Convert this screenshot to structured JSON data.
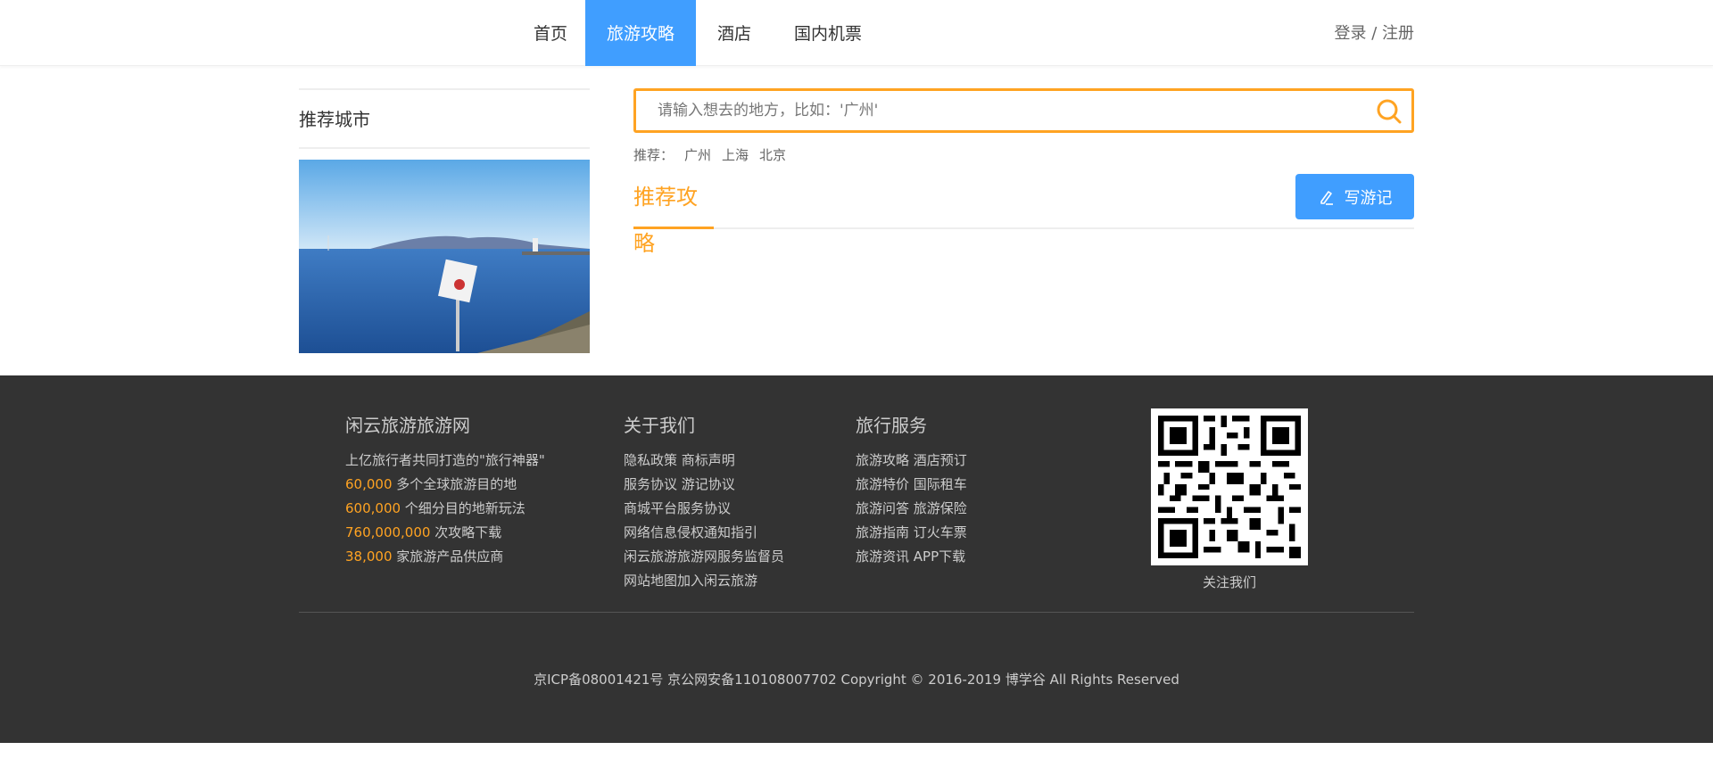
{
  "nav": {
    "items": [
      {
        "label": "首页"
      },
      {
        "label": "旅游攻略"
      },
      {
        "label": "酒店"
      },
      {
        "label": "国内机票"
      }
    ],
    "login": "登录",
    "separator": " / ",
    "register": "注册"
  },
  "aside": {
    "title": "推荐城市"
  },
  "search": {
    "placeholder": "请输入想去的地方，比如：'广州'",
    "recommend_label": "推荐：",
    "recommend_cities": [
      "广州",
      "上海",
      "北京"
    ]
  },
  "tabs": {
    "active": "推荐攻略",
    "write_button": "写游记"
  },
  "footer": {
    "col1": {
      "title": "闲云旅游旅游网",
      "lines": [
        {
          "hl": "",
          "text": "上亿旅行者共同打造的\"旅行神器\""
        },
        {
          "hl": "60,000",
          "text": " 多个全球旅游目的地"
        },
        {
          "hl": "600,000",
          "text": " 个细分目的地新玩法"
        },
        {
          "hl": "760,000,000",
          "text": " 次攻略下载"
        },
        {
          "hl": "38,000",
          "text": " 家旅游产品供应商"
        }
      ]
    },
    "col2": {
      "title": "关于我们",
      "lines": [
        "隐私政策 商标声明",
        "服务协议 游记协议",
        "商城平台服务协议",
        "网络信息侵权通知指引",
        "闲云旅游旅游网服务监督员",
        "网站地图加入闲云旅游"
      ]
    },
    "col3": {
      "title": "旅行服务",
      "lines": [
        "旅游攻略 酒店预订",
        "旅游特价 国际租车",
        "旅游问答 旅游保险",
        "旅游指南 订火车票",
        "旅游资讯 APP下载"
      ]
    },
    "qr_label": "关注我们",
    "copyright": "京ICP备08001421号 京公网安备110108007702 Copyright © 2016-2019 博学谷 All Rights Reserved"
  },
  "colors": {
    "primary": "#409eff",
    "accent": "#ffa322",
    "footer_bg": "#333333"
  }
}
